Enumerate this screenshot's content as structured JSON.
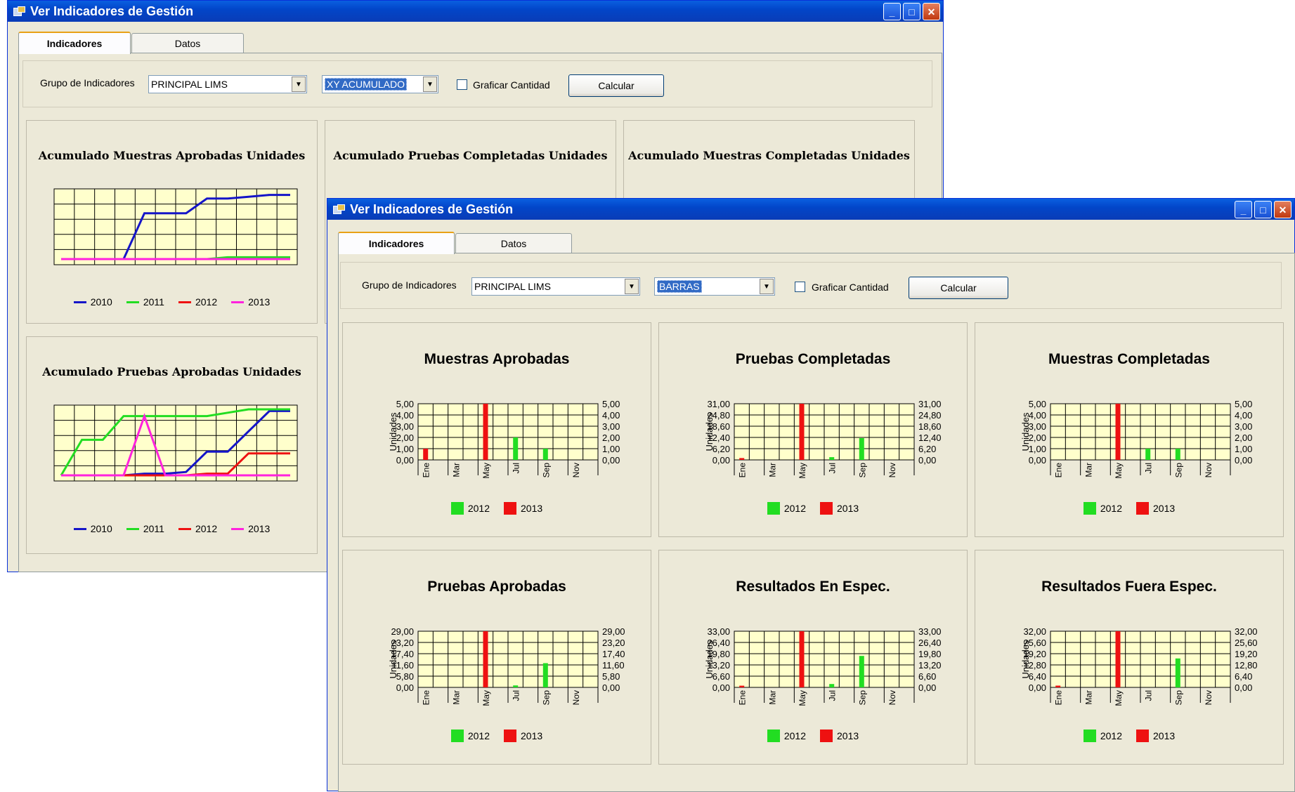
{
  "colors": {
    "green": "#22dd22",
    "red": "#ee1111",
    "blue": "#1515c8",
    "magenta": "#ff22dd",
    "grid_fill": "#ffffcc"
  },
  "back_window": {
    "title": "Ver Indicadores de Gestión",
    "tabs": [
      {
        "label": "Indicadores",
        "active": true
      },
      {
        "label": "Datos",
        "active": false
      }
    ],
    "group_label": "Grupo de Indicadores",
    "group_value": "PRINCIPAL LIMS",
    "type_value": "XY ACUMULADO",
    "checkbox_label": "Graficar Cantidad",
    "calc_label": "Calcular",
    "panels": [
      {
        "title": "Acumulado Muestras Aprobadas Unidades"
      },
      {
        "title": "Acumulado Pruebas Completadas Unidades"
      },
      {
        "title": "Acumulado Muestras Completadas Unidades"
      },
      {
        "title": "Acumulado Pruebas Aprobadas Unidades"
      }
    ],
    "legend": [
      "2010",
      "2011",
      "2012",
      "2013"
    ]
  },
  "front_window": {
    "title": "Ver Indicadores de Gestión",
    "tabs": [
      {
        "label": "Indicadores",
        "active": true
      },
      {
        "label": "Datos",
        "active": false
      }
    ],
    "group_label": "Grupo de Indicadores",
    "group_value": "PRINCIPAL LIMS",
    "type_value": "BARRAS",
    "checkbox_label": "Graficar Cantidad",
    "calc_label": "Calcular",
    "axis_label": "Unidades",
    "legend": [
      "2012",
      "2013"
    ]
  },
  "chart_data": [
    {
      "type": "line",
      "title": "Acumulado Muestras Aprobadas Unidades",
      "x": [
        1,
        2,
        3,
        4,
        5,
        6,
        7,
        8,
        9,
        10,
        11,
        12
      ],
      "series": [
        {
          "name": "2010",
          "values": [
            0,
            0,
            0,
            0,
            2.5,
            2.5,
            2.5,
            3.3,
            3.3,
            3.4,
            3.5,
            3.5
          ]
        },
        {
          "name": "2011",
          "values": [
            0,
            0,
            0,
            0,
            0,
            0,
            0,
            0,
            0.1,
            0.1,
            0.1,
            0.1
          ]
        },
        {
          "name": "2012",
          "values": [
            0,
            0,
            0,
            0,
            0,
            0,
            0,
            0,
            0,
            0,
            0,
            0
          ]
        },
        {
          "name": "2013",
          "values": [
            0,
            0,
            0,
            0,
            0,
            0,
            0,
            0,
            0,
            0,
            0,
            0
          ]
        }
      ]
    },
    {
      "type": "line",
      "title": "Acumulado Pruebas Aprobadas Unidades",
      "x": [
        1,
        2,
        3,
        4,
        5,
        6,
        7,
        8,
        9,
        10,
        11,
        12
      ],
      "series": [
        {
          "name": "2010",
          "values": [
            0,
            0,
            0,
            0,
            0.1,
            0.1,
            0.2,
            1.4,
            1.4,
            2.6,
            3.8,
            3.8
          ]
        },
        {
          "name": "2011",
          "values": [
            0,
            2.1,
            2.1,
            3.5,
            3.5,
            3.5,
            3.5,
            3.5,
            3.7,
            3.9,
            3.9,
            3.9
          ]
        },
        {
          "name": "2012",
          "values": [
            0,
            0,
            0,
            0,
            0,
            0,
            0,
            0.1,
            0.1,
            1.3,
            1.3,
            1.3
          ]
        },
        {
          "name": "2013",
          "values": [
            0,
            0,
            0,
            0,
            3.5,
            0,
            0,
            0,
            0,
            0,
            0,
            0
          ]
        }
      ]
    },
    {
      "type": "bar",
      "title": "Muestras Aprobadas",
      "ylabel": "Unidades",
      "ylim": [
        0,
        5
      ],
      "yticks": [
        "5,00",
        "4,00",
        "3,00",
        "2,00",
        "1,00",
        "0,00"
      ],
      "categories": [
        "Ene",
        "Feb",
        "Mar",
        "Abr",
        "May",
        "Jun",
        "Jul",
        "Ago",
        "Sep",
        "Oct",
        "Nov",
        "Dic"
      ],
      "tick_labels": [
        "Ene",
        "Mar",
        "May",
        "Jul",
        "Sep",
        "Nov"
      ],
      "series": [
        {
          "name": "2012",
          "values": [
            0,
            0,
            0,
            0,
            0,
            0,
            2,
            0,
            1,
            0,
            0,
            0
          ]
        },
        {
          "name": "2013",
          "values": [
            1,
            0,
            0,
            0,
            5,
            0,
            0,
            0,
            0,
            0,
            0,
            0
          ]
        }
      ]
    },
    {
      "type": "bar",
      "title": "Pruebas Completadas",
      "ylabel": "Unidades",
      "ylim": [
        0,
        31
      ],
      "yticks": [
        "31,00",
        "24,80",
        "18,60",
        "12,40",
        "6,20",
        "0,00"
      ],
      "categories": [
        "Ene",
        "Feb",
        "Mar",
        "Abr",
        "May",
        "Jun",
        "Jul",
        "Ago",
        "Sep",
        "Oct",
        "Nov",
        "Dic"
      ],
      "tick_labels": [
        "Ene",
        "Mar",
        "May",
        "Jul",
        "Sep",
        "Nov"
      ],
      "series": [
        {
          "name": "2012",
          "values": [
            0,
            0,
            0,
            0,
            0,
            0,
            1.5,
            0,
            12,
            0,
            0,
            0
          ]
        },
        {
          "name": "2013",
          "values": [
            1,
            0,
            0,
            0,
            31,
            0,
            0,
            0,
            0,
            0,
            0,
            0
          ]
        }
      ]
    },
    {
      "type": "bar",
      "title": "Muestras Completadas",
      "ylabel": "Unidades",
      "ylim": [
        0,
        5
      ],
      "yticks": [
        "5,00",
        "4,00",
        "3,00",
        "2,00",
        "1,00",
        "0,00"
      ],
      "categories": [
        "Ene",
        "Feb",
        "Mar",
        "Abr",
        "May",
        "Jun",
        "Jul",
        "Ago",
        "Sep",
        "Oct",
        "Nov",
        "Dic"
      ],
      "tick_labels": [
        "Ene",
        "Mar",
        "May",
        "Jul",
        "Sep",
        "Nov"
      ],
      "series": [
        {
          "name": "2012",
          "values": [
            0,
            0,
            0,
            0,
            0,
            0,
            1,
            0,
            1,
            0,
            0,
            0
          ]
        },
        {
          "name": "2013",
          "values": [
            0,
            0,
            0,
            0,
            5,
            0,
            0,
            0,
            0,
            0,
            0,
            0
          ]
        }
      ]
    },
    {
      "type": "bar",
      "title": "Pruebas Aprobadas",
      "ylabel": "Unidades",
      "ylim": [
        0,
        29
      ],
      "yticks": [
        "29,00",
        "23,20",
        "17,40",
        "11,60",
        "5,80",
        "0,00"
      ],
      "categories": [
        "Ene",
        "Feb",
        "Mar",
        "Abr",
        "May",
        "Jun",
        "Jul",
        "Ago",
        "Sep",
        "Oct",
        "Nov",
        "Dic"
      ],
      "tick_labels": [
        "Ene",
        "Mar",
        "May",
        "Jul",
        "Sep",
        "Nov"
      ],
      "series": [
        {
          "name": "2012",
          "values": [
            0,
            0,
            0,
            0,
            0,
            0,
            1,
            0,
            12.5,
            0,
            0,
            0
          ]
        },
        {
          "name": "2013",
          "values": [
            0,
            0,
            0,
            0,
            29,
            0,
            0,
            0,
            0,
            0,
            0,
            0
          ]
        }
      ]
    },
    {
      "type": "bar",
      "title": "Resultados En Espec.",
      "ylabel": "Unidades",
      "ylim": [
        0,
        33
      ],
      "yticks": [
        "33,00",
        "26,40",
        "19,80",
        "13,20",
        "6,60",
        "0,00"
      ],
      "categories": [
        "Ene",
        "Feb",
        "Mar",
        "Abr",
        "May",
        "Jun",
        "Jul",
        "Ago",
        "Sep",
        "Oct",
        "Nov",
        "Dic"
      ],
      "tick_labels": [
        "Ene",
        "Mar",
        "May",
        "Jul",
        "Sep",
        "Nov"
      ],
      "series": [
        {
          "name": "2012",
          "values": [
            0,
            0,
            0,
            0,
            0,
            0,
            2,
            0,
            18.5,
            0,
            0,
            0
          ]
        },
        {
          "name": "2013",
          "values": [
            1,
            0,
            0,
            0,
            33,
            0,
            0,
            0,
            0,
            0,
            0,
            0
          ]
        }
      ]
    },
    {
      "type": "bar",
      "title": "Resultados Fuera Espec.",
      "ylabel": "Unidades",
      "ylim": [
        0,
        32
      ],
      "yticks": [
        "32,00",
        "25,60",
        "19,20",
        "12,80",
        "6,40",
        "0,00"
      ],
      "categories": [
        "Ene",
        "Feb",
        "Mar",
        "Abr",
        "May",
        "Jun",
        "Jul",
        "Ago",
        "Sep",
        "Oct",
        "Nov",
        "Dic"
      ],
      "tick_labels": [
        "Ene",
        "Mar",
        "May",
        "Jul",
        "Sep",
        "Nov"
      ],
      "series": [
        {
          "name": "2012",
          "values": [
            0,
            0,
            0,
            0,
            0,
            0,
            0,
            0,
            16.5,
            0,
            0,
            0
          ]
        },
        {
          "name": "2013",
          "values": [
            1,
            0,
            0,
            0,
            32,
            0,
            0,
            0,
            0,
            0,
            0,
            0
          ]
        }
      ]
    }
  ]
}
